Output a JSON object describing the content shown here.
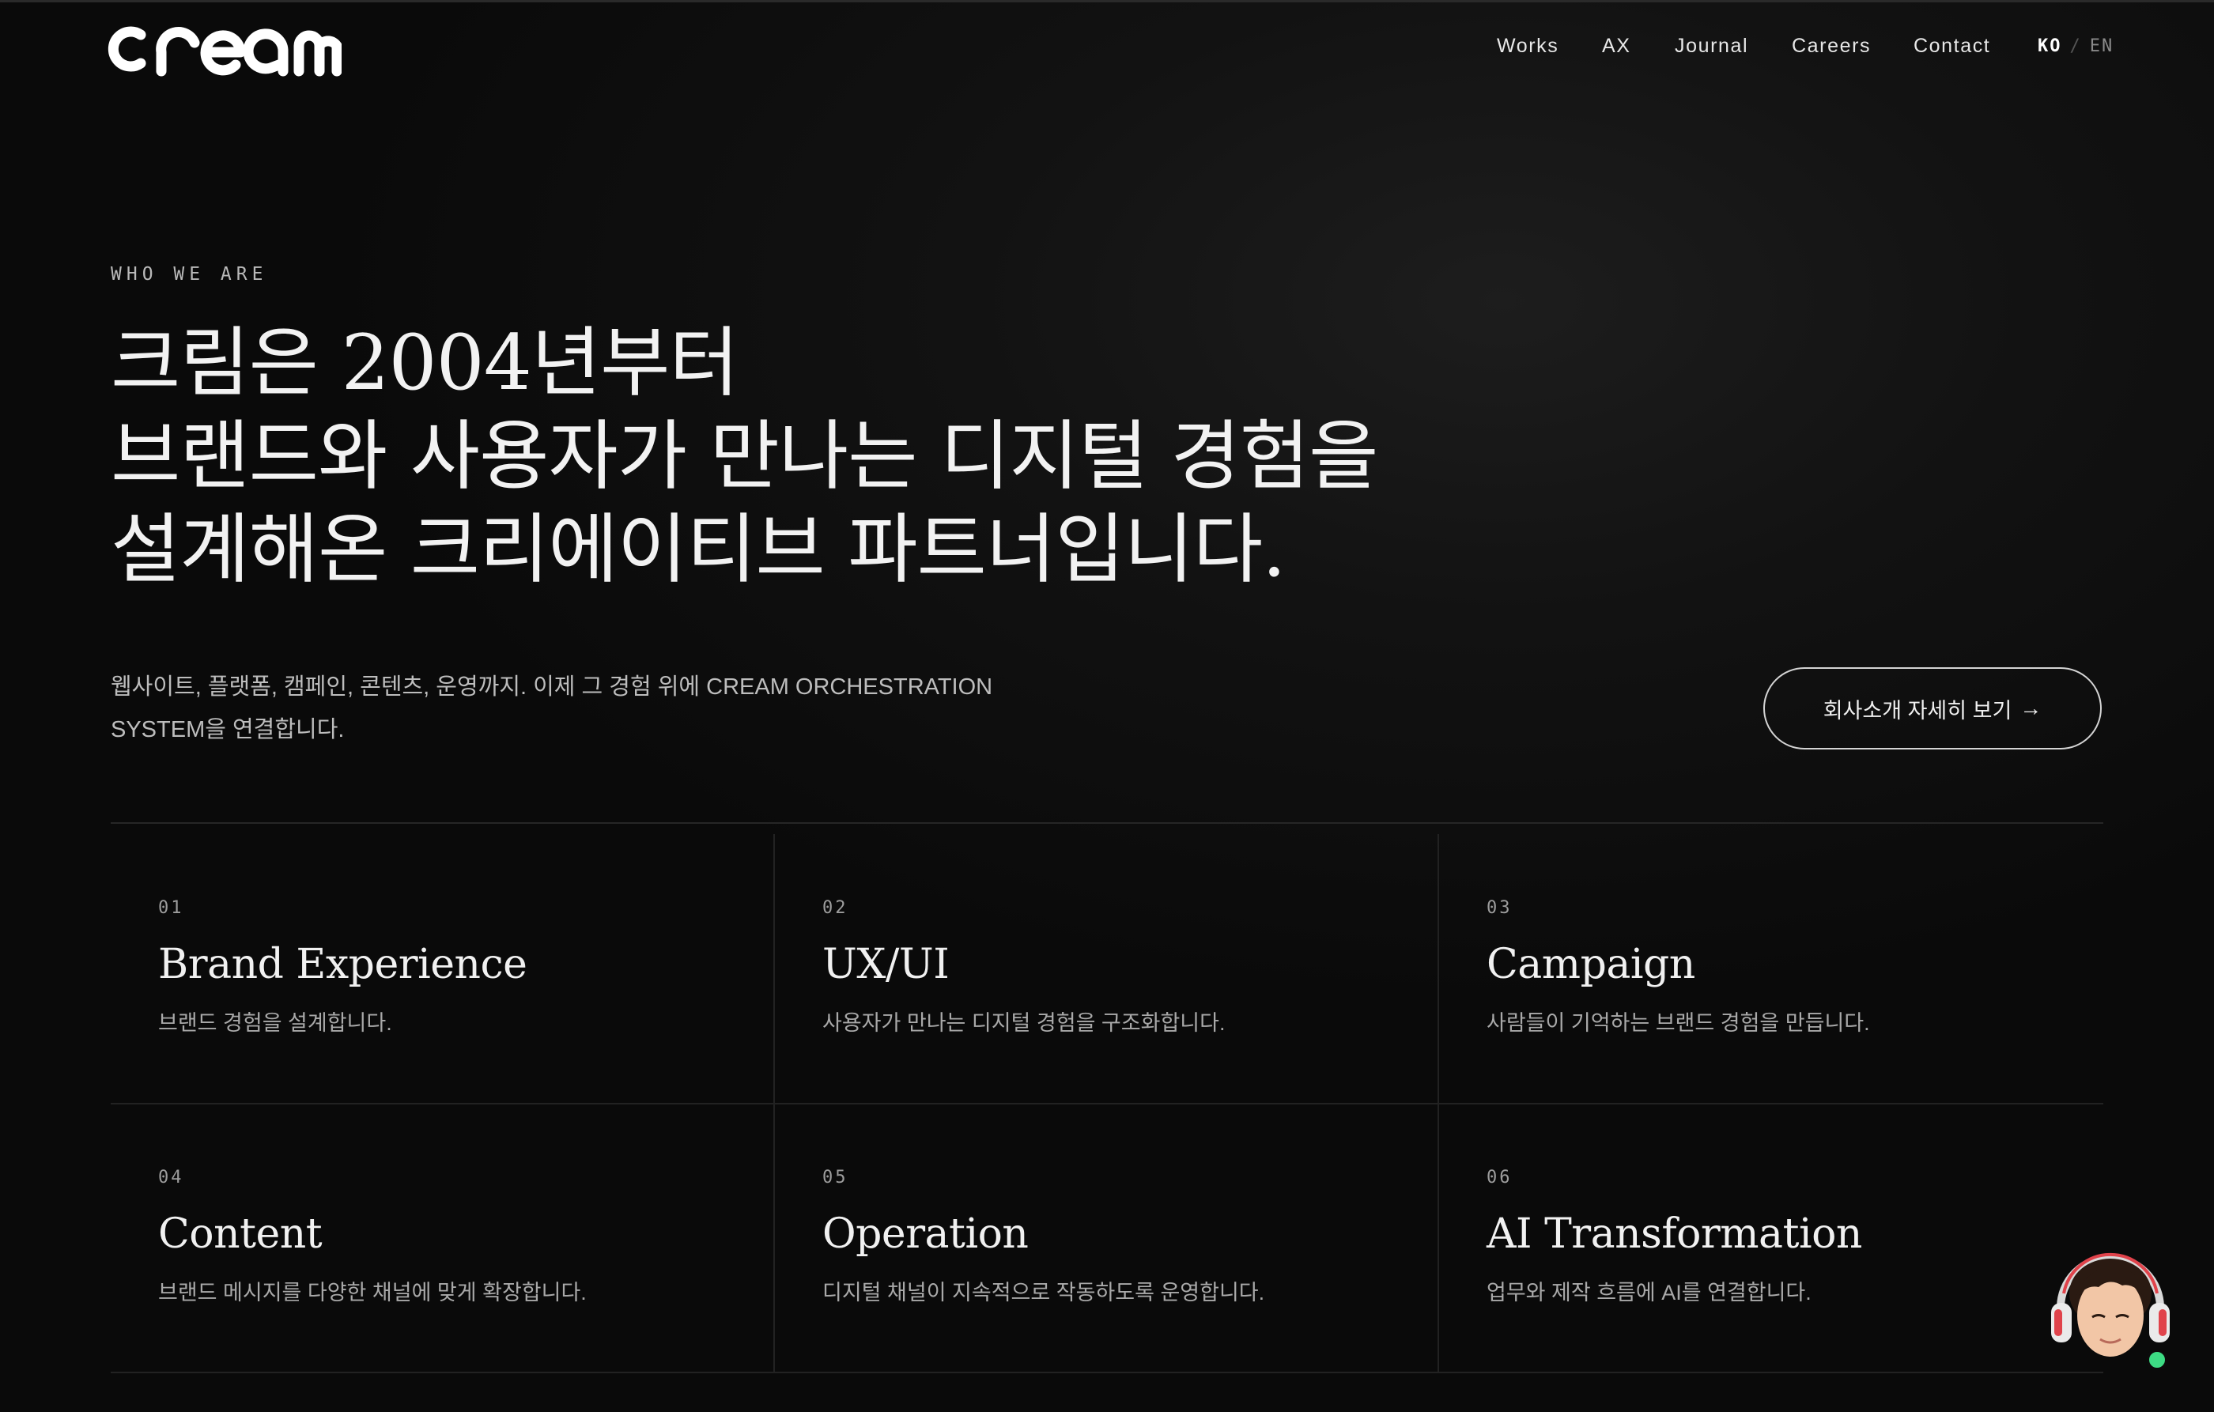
{
  "brand": {
    "logo_text": "cream"
  },
  "nav": {
    "items": [
      "Works",
      "AX",
      "Journal",
      "Careers",
      "Contact"
    ],
    "lang": {
      "ko": "KO",
      "sep": "/",
      "en": "EN"
    }
  },
  "hero": {
    "eyebrow": "WHO WE ARE",
    "headline": [
      "크림은 2004년부터",
      "브랜드와 사용자가 만나는 디지털 경험을",
      "설계해온 크리에이티브 파트너입니다."
    ],
    "intro_line1": "웹사이트, 플랫폼, 캠페인, 콘텐츠, 운영까지. 이제 그 경험 위에 CREAM ORCHESTRATION",
    "intro_line2": "SYSTEM을 연결합니다.",
    "cta_label": "회사소개 자세히 보기",
    "cta_arrow": "→"
  },
  "services": [
    {
      "num": "01",
      "title": "Brand Experience",
      "desc": "브랜드 경험을 설계합니다."
    },
    {
      "num": "02",
      "title": "UX/UI",
      "desc": "사용자가 만나는 디지털 경험을 구조화합니다."
    },
    {
      "num": "03",
      "title": "Campaign",
      "desc": "사람들이 기억하는 브랜드 경험을 만듭니다."
    },
    {
      "num": "04",
      "title": "Content",
      "desc": "브랜드 메시지를 다양한 채널에 맞게 확장합니다."
    },
    {
      "num": "05",
      "title": "Operation",
      "desc": "디지털 채널이 지속적으로 작동하도록 운영합니다."
    },
    {
      "num": "06",
      "title": "AI Transformation",
      "desc": "업무와 제작 흐름에 AI를 연결합니다."
    }
  ],
  "colors": {
    "background": "#0b0b0b",
    "text": "#f2f2f2",
    "muted": "#a9a9a9",
    "online": "#3ddc84"
  }
}
